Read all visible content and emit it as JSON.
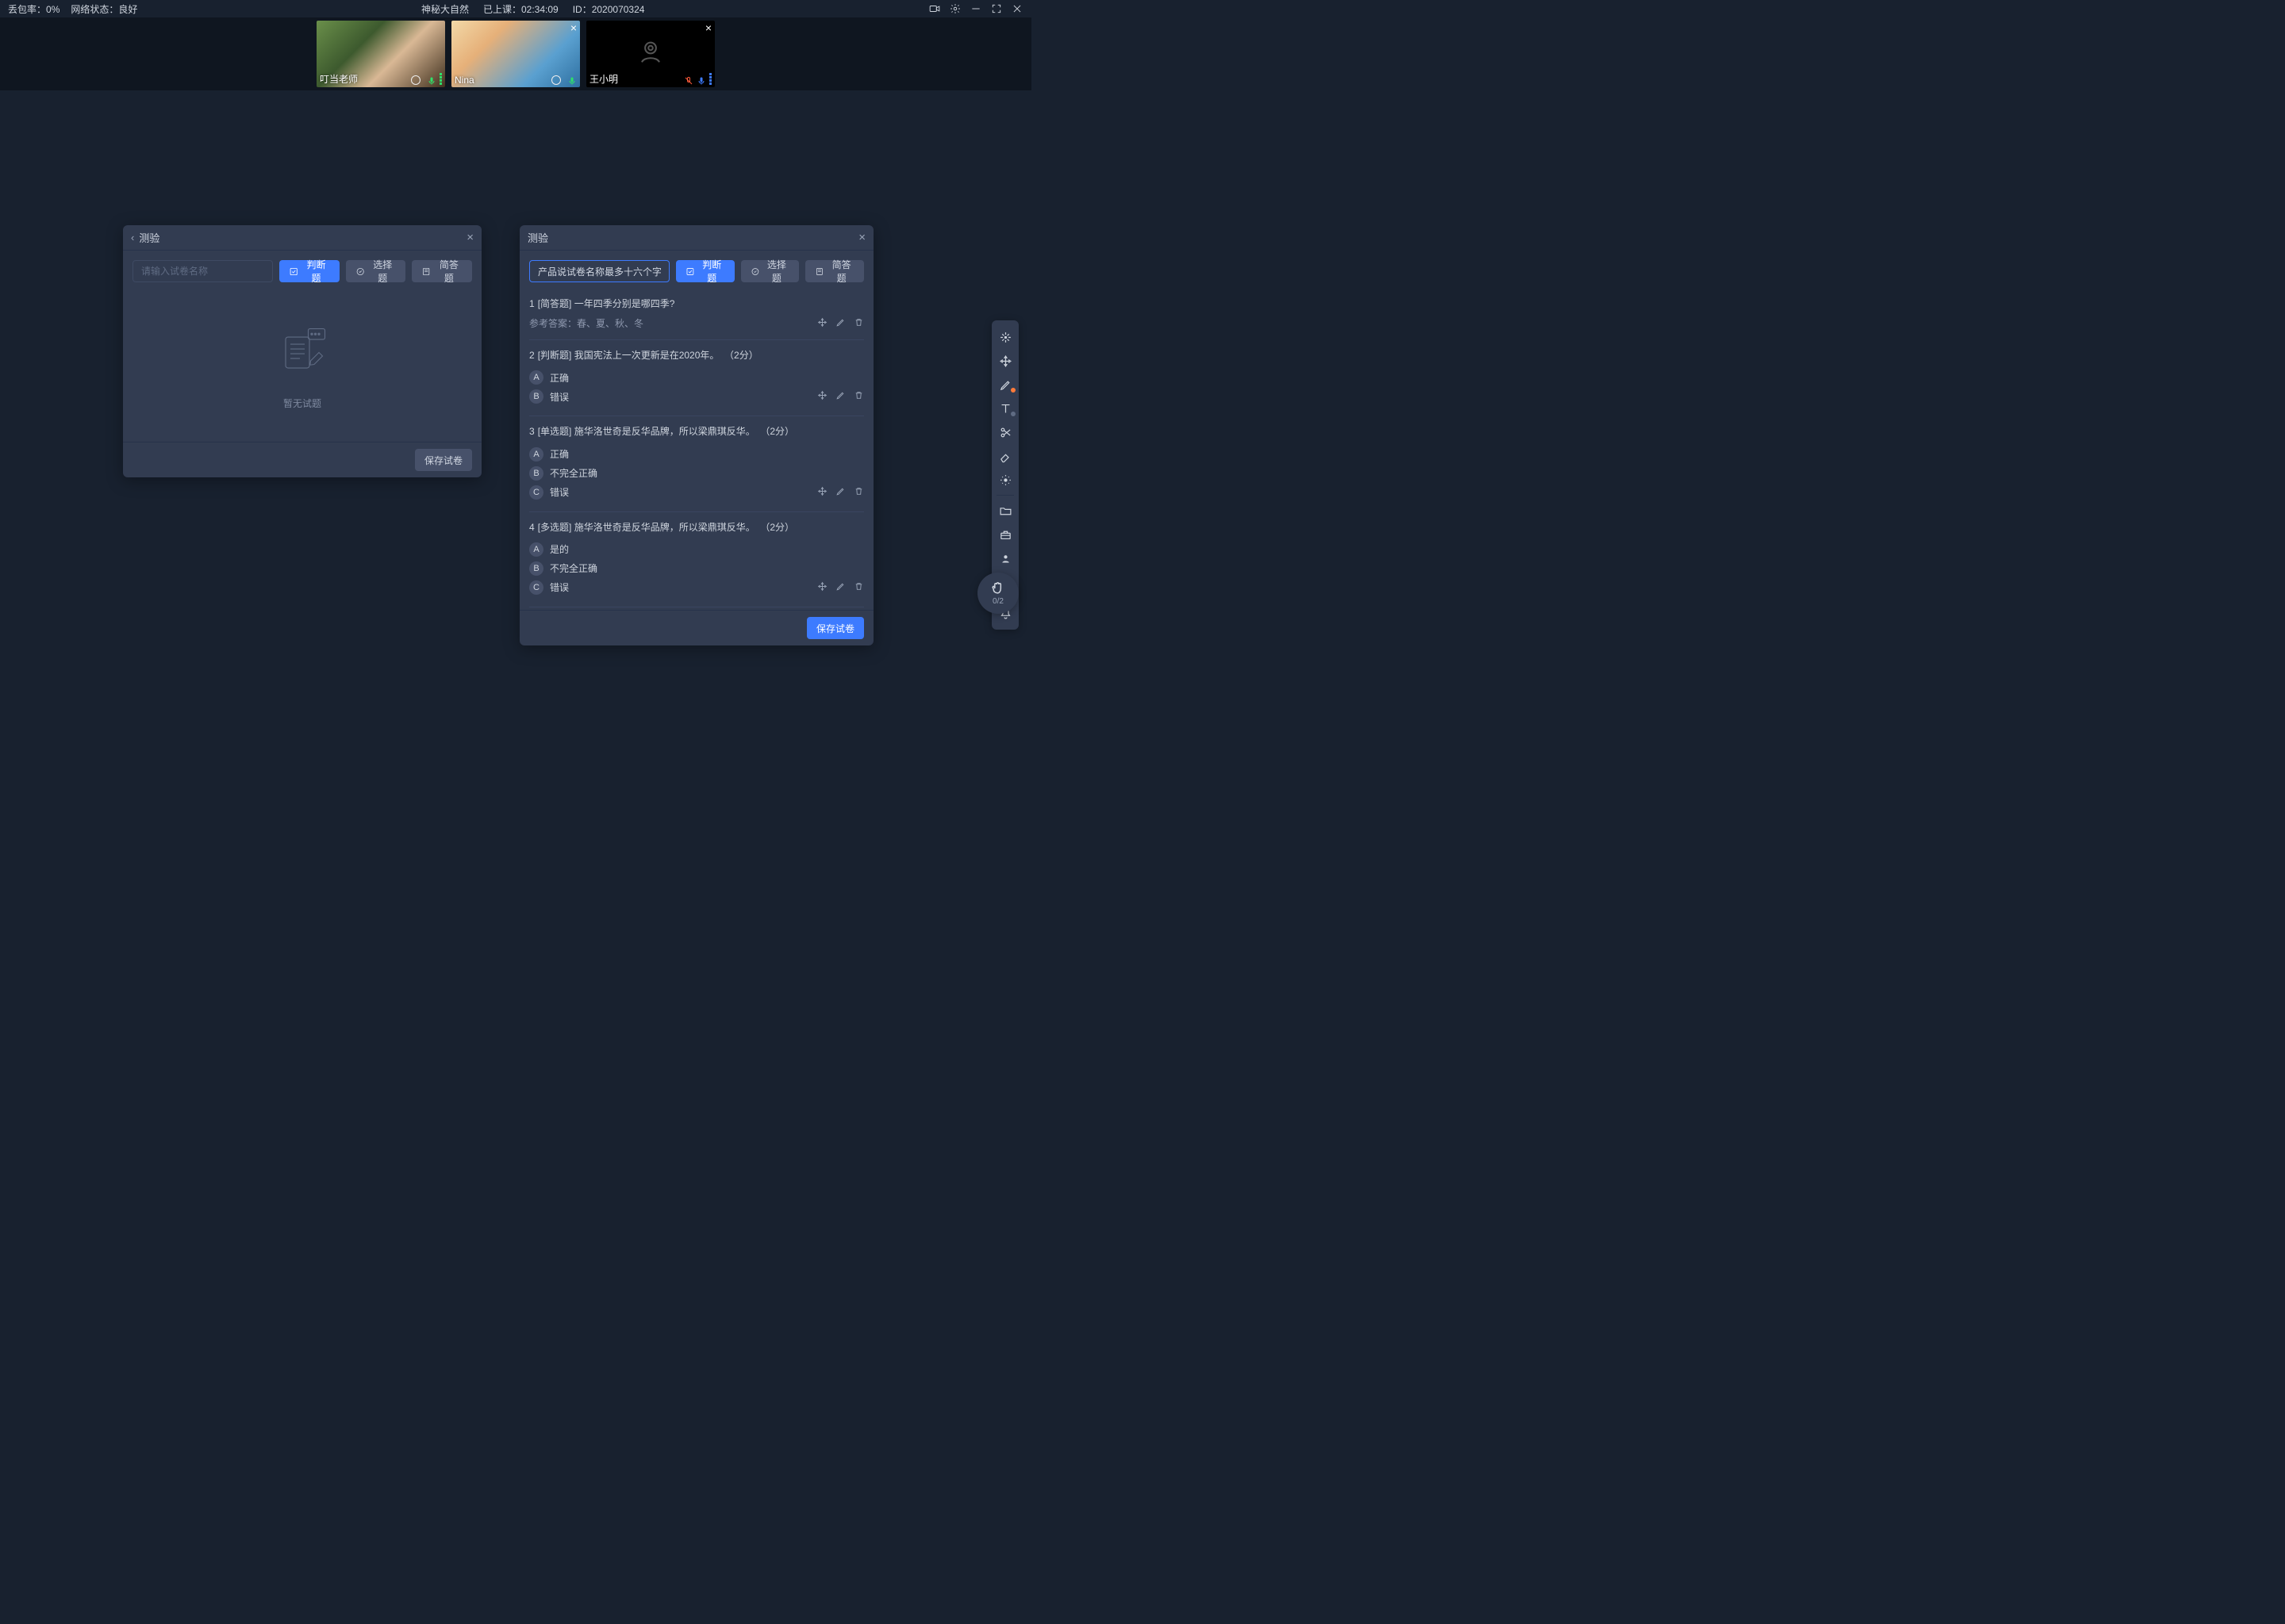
{
  "topbar": {
    "packet_loss_label": "丢包率：",
    "packet_loss_value": "0%",
    "network_label": "网络状态：",
    "network_value": "良好",
    "course_title": "神秘大自然",
    "elapsed_label": "已上课：",
    "elapsed_value": "02:34:09",
    "id_label": "ID：",
    "id_value": "2020070324"
  },
  "tiles": [
    {
      "name": "叮当老师",
      "closeable": false
    },
    {
      "name": "Nina",
      "closeable": true
    },
    {
      "name": "王小明",
      "closeable": true,
      "cam_off": true,
      "mic_muted": true
    }
  ],
  "panel1": {
    "title": "测验",
    "search_placeholder": "请输入试卷名称",
    "btn_judge": "判断题",
    "btn_choice": "选择题",
    "btn_short": "简答题",
    "empty_text": "暂无试题",
    "save_btn": "保存试卷"
  },
  "panel2": {
    "title": "测验",
    "filled_title": "产品说试卷名称最多十六个字",
    "btn_judge": "判断题",
    "btn_choice": "选择题",
    "btn_short": "简答题",
    "save_btn": "保存试卷",
    "questions": [
      {
        "no": "1",
        "type_label": "[简答题]",
        "text": "一年四季分别是哪四季?",
        "ref_label": "参考答案：",
        "ref_answer": "春、夏、秋、冬",
        "show_ops_on": "ref",
        "options": []
      },
      {
        "no": "2",
        "type_label": "[判断题]",
        "text": "我国宪法上一次更新是在2020年。",
        "score": "（2分）",
        "options": [
          {
            "letter": "A",
            "text": "正确"
          },
          {
            "letter": "B",
            "text": "错误",
            "show_ops": true
          }
        ]
      },
      {
        "no": "3",
        "type_label": "[单选题]",
        "text": "施华洛世奇是反华品牌，所以梁鼎琪反华。",
        "score": "（2分）",
        "options": [
          {
            "letter": "A",
            "text": "正确"
          },
          {
            "letter": "B",
            "text": "不完全正确"
          },
          {
            "letter": "C",
            "text": "错误",
            "show_ops": true
          }
        ]
      },
      {
        "no": "4",
        "type_label": "[多选题]",
        "text": "施华洛世奇是反华品牌，所以梁鼎琪反华。",
        "score": "（2分）",
        "options": [
          {
            "letter": "A",
            "text": "是的"
          },
          {
            "letter": "B",
            "text": "不完全正确"
          },
          {
            "letter": "C",
            "text": "错误",
            "show_ops": true
          }
        ]
      }
    ]
  },
  "handbtn": {
    "count": "0/2"
  }
}
